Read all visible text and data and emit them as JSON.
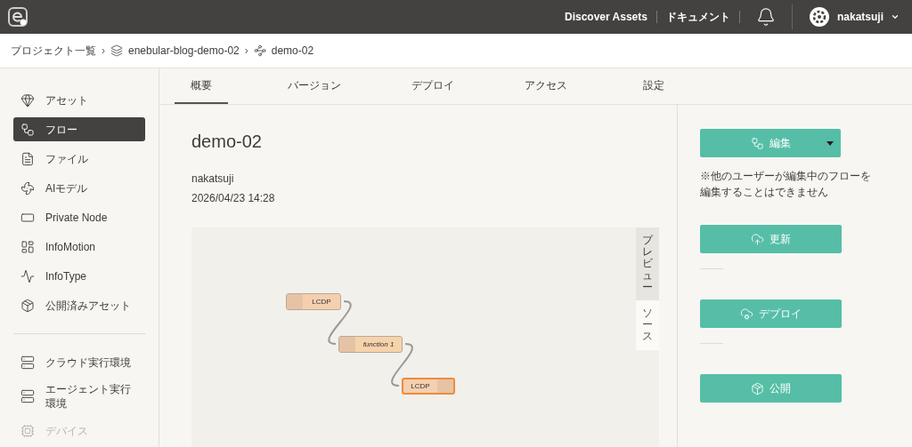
{
  "header": {
    "links": [
      "Discover Assets",
      "ドキュメント"
    ],
    "user": "nakatsuji"
  },
  "breadcrumb": [
    "プロジェクト一覧",
    "enebular-blog-demo-02",
    "demo-02"
  ],
  "breadcrumb_separator": "›",
  "sidebar": {
    "items": [
      {
        "label": "アセット",
        "kind": "asset",
        "selected": false,
        "disabled": false
      },
      {
        "label": "フロー",
        "kind": "flow",
        "selected": true,
        "disabled": false
      },
      {
        "label": "ファイル",
        "kind": "file",
        "selected": false,
        "disabled": false
      },
      {
        "label": "AIモデル",
        "kind": "ai",
        "selected": false,
        "disabled": false
      },
      {
        "label": "Private Node",
        "kind": "node",
        "selected": false,
        "disabled": false
      },
      {
        "label": "InfoMotion",
        "kind": "infomotion",
        "selected": false,
        "disabled": false
      },
      {
        "label": "InfoType",
        "kind": "infotype",
        "selected": false,
        "disabled": false
      },
      {
        "label": "公開済みアセット",
        "kind": "published",
        "selected": false,
        "disabled": false
      }
    ],
    "runtime_items": [
      {
        "label": "クラウド実行環境",
        "kind": "cloud",
        "selected": false,
        "disabled": false
      },
      {
        "label": "エージェント実行環境",
        "kind": "agent",
        "selected": false,
        "disabled": false
      },
      {
        "label": "デバイス",
        "kind": "device",
        "selected": false,
        "disabled": true
      }
    ]
  },
  "tabs": [
    {
      "label": "概要",
      "selected": true
    },
    {
      "label": "バージョン",
      "selected": false
    },
    {
      "label": "デプロイ",
      "selected": false
    },
    {
      "label": "アクセス",
      "selected": false
    },
    {
      "label": "設定",
      "selected": false
    }
  ],
  "flow": {
    "name": "demo-02",
    "owner": "nakatsuji",
    "updated": "2026/04/23 14:28",
    "view_tabs": [
      {
        "label": "プレビュー",
        "selected": true
      },
      {
        "label": "ソース",
        "selected": false
      }
    ],
    "nodes": [
      {
        "label": "LCDP",
        "kind": "input",
        "selected": false
      },
      {
        "label": "function 1",
        "kind": "function",
        "selected": false
      },
      {
        "label": "LCDP",
        "kind": "output",
        "selected": true
      }
    ]
  },
  "actions": {
    "edit": "編集",
    "note": "※他のユーザーが編集中のフローを編集することはできません",
    "buttons": [
      {
        "label": "更新",
        "kind": "update"
      },
      {
        "label": "デプロイ",
        "kind": "deploy"
      },
      {
        "label": "公開",
        "kind": "publish"
      }
    ]
  }
}
